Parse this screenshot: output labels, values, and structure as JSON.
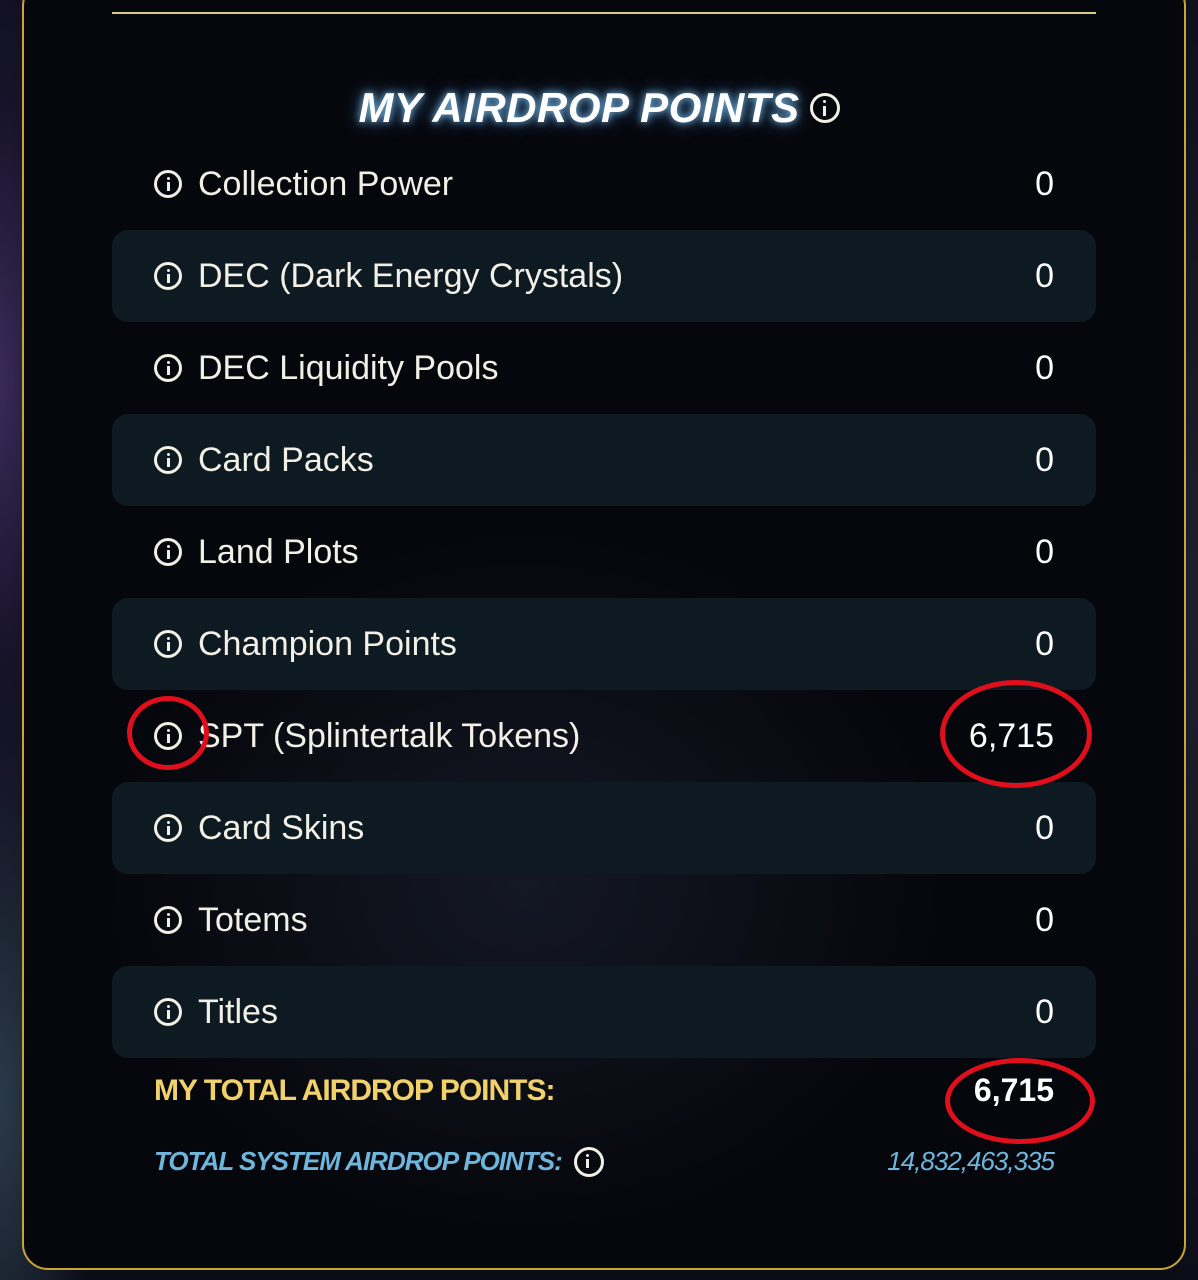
{
  "panel": {
    "title": "MY AIRDROP POINTS",
    "title_icon": "info-icon"
  },
  "rows": [
    {
      "label": "Collection Power",
      "value": "0",
      "icon": "info-icon"
    },
    {
      "label": "DEC (Dark Energy Crystals)",
      "value": "0",
      "icon": "info-icon"
    },
    {
      "label": "DEC Liquidity Pools",
      "value": "0",
      "icon": "info-icon"
    },
    {
      "label": "Card Packs",
      "value": "0",
      "icon": "info-icon"
    },
    {
      "label": "Land Plots",
      "value": "0",
      "icon": "info-icon"
    },
    {
      "label": "Champion Points",
      "value": "0",
      "icon": "info-icon"
    },
    {
      "label": "SPT (Splintertalk Tokens)",
      "value": "6,715",
      "icon": "info-icon"
    },
    {
      "label": "Card Skins",
      "value": "0",
      "icon": "info-icon"
    },
    {
      "label": "Totems",
      "value": "0",
      "icon": "info-icon"
    },
    {
      "label": "Titles",
      "value": "0",
      "icon": "info-icon"
    }
  ],
  "total": {
    "label": "MY TOTAL AIRDROP POINTS:",
    "value": "6,715"
  },
  "system": {
    "label": "TOTAL SYSTEM AIRDROP POINTS:",
    "value": "14,832,463,335",
    "icon": "info-icon"
  },
  "colors": {
    "accent_gold": "#c8a534",
    "total_label": "#f1d26a",
    "system_text": "#6fb6dc",
    "annotation_red": "#e10f1c"
  }
}
